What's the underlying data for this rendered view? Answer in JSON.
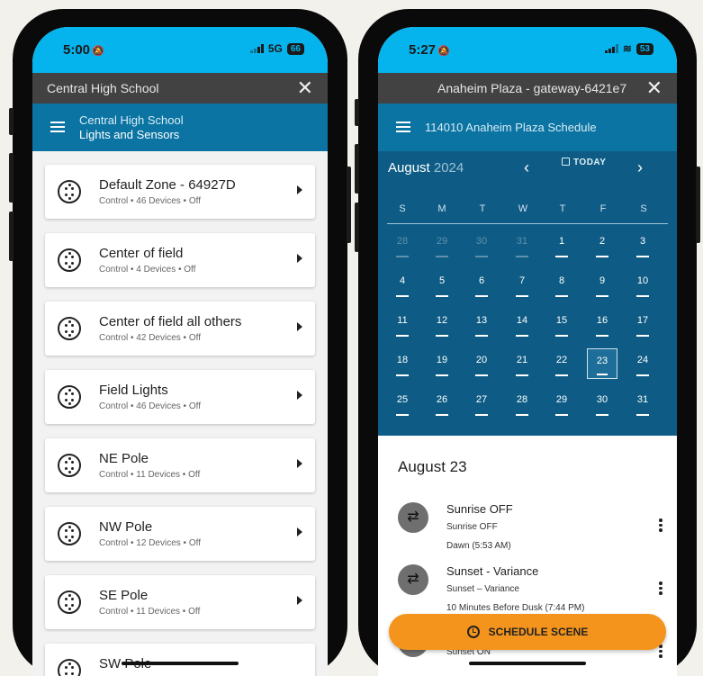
{
  "phone_left": {
    "status": {
      "time": "5:00",
      "network": "5G",
      "battery": "66"
    },
    "titlebar": {
      "title": "Central High School",
      "close": "✕"
    },
    "appbar": {
      "line1": "Central High School",
      "line2": "Lights and Sensors"
    },
    "zones": [
      {
        "name": "Default Zone - 64927D",
        "meta": "Control  •  46 Devices  •  Off"
      },
      {
        "name": "Center of field",
        "meta": "Control  •  4 Devices  •  Off"
      },
      {
        "name": "Center of field all others",
        "meta": "Control  •  42 Devices  •  Off"
      },
      {
        "name": "Field Lights",
        "meta": "Control  •  46 Devices  •  Off"
      },
      {
        "name": "NE Pole",
        "meta": "Control  •  11 Devices  •  Off"
      },
      {
        "name": "NW Pole",
        "meta": "Control  •  12 Devices  •  Off"
      },
      {
        "name": "SE Pole",
        "meta": "Control  •  11 Devices  •  Off"
      },
      {
        "name": "SW Pole",
        "meta": ""
      }
    ]
  },
  "phone_right": {
    "status": {
      "time": "5:27",
      "battery": "53"
    },
    "titlebar": {
      "title": "Anaheim Plaza - gateway-6421e7",
      "close": "✕"
    },
    "appbar": {
      "title": "114010 Anaheim Plaza Schedule"
    },
    "calendar": {
      "month": "August",
      "year": "2024",
      "today_label": "TODAY",
      "prev": "‹",
      "next": "›",
      "weekdays": [
        "S",
        "M",
        "T",
        "W",
        "T",
        "F",
        "S"
      ],
      "weeks": [
        [
          "28",
          "29",
          "30",
          "31",
          "1",
          "2",
          "3"
        ],
        [
          "4",
          "5",
          "6",
          "7",
          "8",
          "9",
          "10"
        ],
        [
          "11",
          "12",
          "13",
          "14",
          "15",
          "16",
          "17"
        ],
        [
          "18",
          "19",
          "20",
          "21",
          "22",
          "23",
          "24"
        ],
        [
          "25",
          "26",
          "27",
          "28",
          "29",
          "30",
          "31"
        ]
      ],
      "selected_day": "23"
    },
    "detail": {
      "date_title": "August 23",
      "events": [
        {
          "name": "Sunrise OFF",
          "sub1": "Sunrise OFF",
          "sub2": "Dawn (5:53 AM)"
        },
        {
          "name": "Sunset - Variance",
          "sub1": "Sunset – Variance",
          "sub2": "10 Minutes Before Dusk (7:44 PM)"
        },
        {
          "name": "",
          "sub1": "Sunset ON",
          "sub2": ""
        }
      ]
    },
    "fab_label": "SCHEDULE SCENE"
  },
  "colors": {
    "status_bar": "#05b3ed",
    "title_bar": "#424242",
    "app_bar": "#0b74a3",
    "calendar_bg": "#0e5c85",
    "fab": "#f4941c"
  }
}
